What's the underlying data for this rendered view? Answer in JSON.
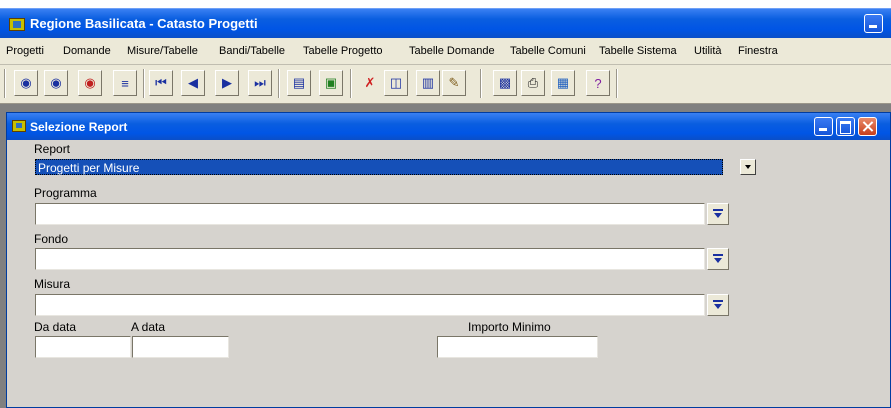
{
  "app": {
    "title": "Regione Basilicata - Catasto Progetti"
  },
  "menu": [
    "Progetti",
    "Domande",
    "Misure/Tabelle",
    "Bandi/Tabelle",
    "Tabelle Progetto",
    "Tabelle Domande",
    "Tabelle Comuni",
    "Tabelle Sistema",
    "Utilità",
    "Finestra"
  ],
  "toolbar": {
    "icons": [
      "binoculars-query-icon",
      "binoculars-icon",
      "binoculars-red-icon",
      "list-of-values-icon",
      "first-record-icon",
      "previous-record-icon",
      "next-record-icon",
      "last-record-icon",
      "new-record-icon",
      "form-icon",
      "delete-icon",
      "copy-icon",
      "paste-icon",
      "edit-icon",
      "save-icon",
      "print-icon",
      "exit-icon",
      "help-icon"
    ]
  },
  "window": {
    "title": "Selezione Report"
  },
  "form": {
    "report_label": "Report",
    "report_value": "Progetti per Misure",
    "programma_label": "Programma",
    "programma_value": "",
    "fondo_label": "Fondo",
    "fondo_value": "",
    "misura_label": "Misura",
    "misura_value": "",
    "da_data_label": "Da data",
    "da_data_value": "",
    "a_data_label": "A data",
    "a_data_value": "",
    "importo_label": "Importo Minimo",
    "importo_value": ""
  },
  "colors": {
    "titlebar": "#0055e5",
    "selection": "#1550b8",
    "face": "#d6d3ce"
  }
}
